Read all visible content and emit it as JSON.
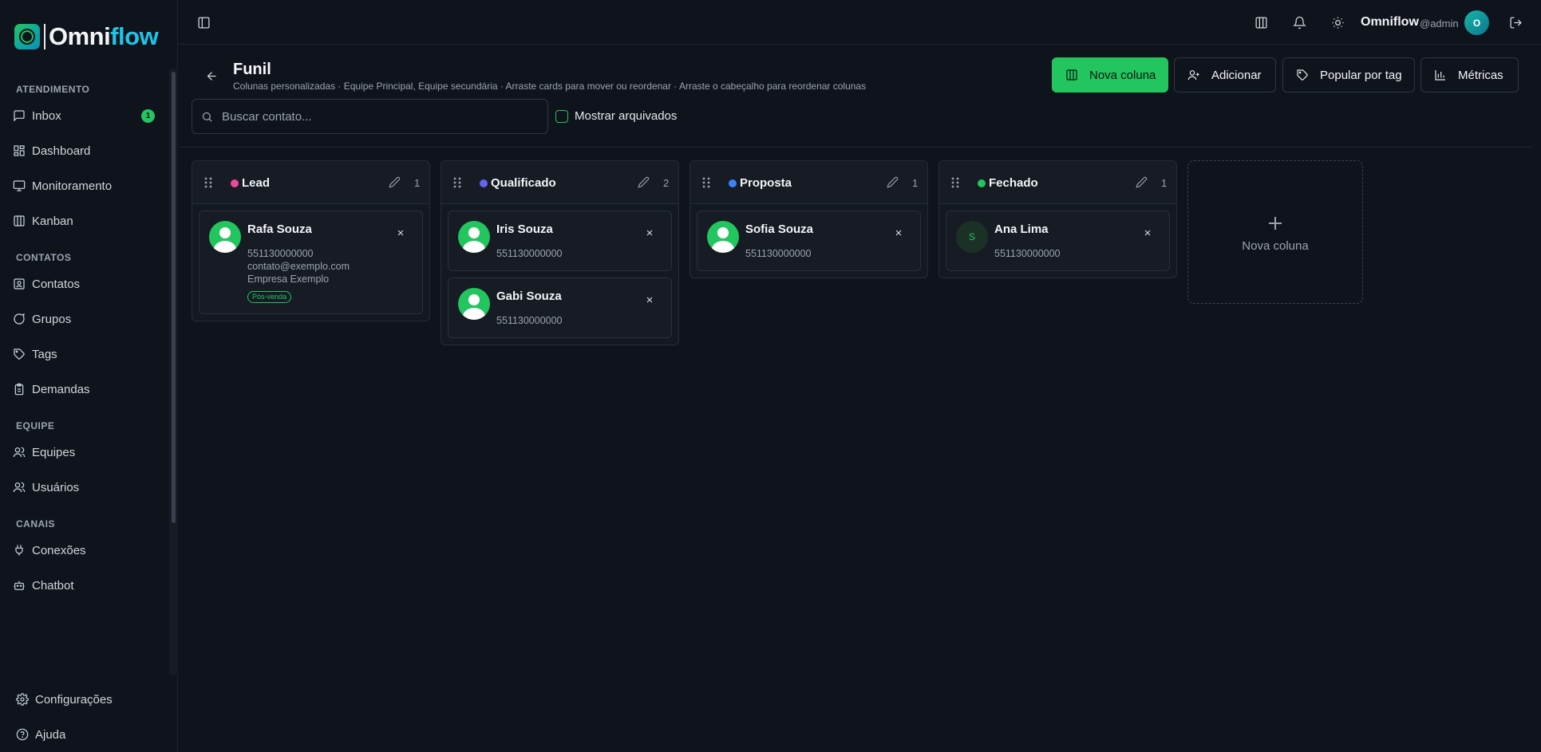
{
  "brand": {
    "part1": "Omni",
    "part2": "flow"
  },
  "sidebar": {
    "sections": [
      {
        "title": "ATENDIMENTO",
        "items": [
          {
            "label": "Inbox",
            "icon": "message-square-icon",
            "badge": "1"
          },
          {
            "label": "Dashboard",
            "icon": "dashboard-icon"
          },
          {
            "label": "Monitoramento",
            "icon": "monitor-icon"
          },
          {
            "label": "Kanban",
            "icon": "kanban-icon"
          }
        ]
      },
      {
        "title": "CONTATOS",
        "items": [
          {
            "label": "Contatos",
            "icon": "contact-icon"
          },
          {
            "label": "Grupos",
            "icon": "chat-bubble-icon"
          },
          {
            "label": "Tags",
            "icon": "tag-icon"
          },
          {
            "label": "Demandas",
            "icon": "clipboard-icon"
          }
        ]
      },
      {
        "title": "EQUIPE",
        "items": [
          {
            "label": "Equipes",
            "icon": "users-icon"
          },
          {
            "label": "Usuários",
            "icon": "users-icon"
          }
        ]
      },
      {
        "title": "CANAIS",
        "items": [
          {
            "label": "Conexões",
            "icon": "plug-icon"
          },
          {
            "label": "Chatbot",
            "icon": "bot-icon"
          }
        ]
      }
    ],
    "bottom": [
      {
        "label": "Configurações",
        "icon": "gear-icon"
      },
      {
        "label": "Ajuda",
        "icon": "help-circle-icon"
      }
    ]
  },
  "topbar": {
    "user_name": "Omniflow",
    "user_handle": "@admin",
    "avatar_initial": "O"
  },
  "page": {
    "title": "Funil",
    "subtitle": "Colunas personalizadas · Equipe Principal, Equipe secundária · Arraste cards para mover ou reordenar · Arraste o cabeçalho para reordenar colunas",
    "buttons": {
      "new_column": "Nova coluna",
      "add": "Adicionar",
      "populate": "Popular por tag",
      "metrics": "Métricas"
    },
    "search_placeholder": "Buscar contato...",
    "show_archived": "Mostrar arquivados"
  },
  "columns": [
    {
      "title": "Lead",
      "color": "#ec4899",
      "count": "1",
      "cards": [
        {
          "name": "Rafa Souza",
          "phone": "551130000000",
          "email": "contato@exemplo.com",
          "company": "Empresa Exemplo",
          "tag": "Pós-venda",
          "avatar": "photo"
        }
      ]
    },
    {
      "title": "Qualificado",
      "color": "#6366f1",
      "count": "2",
      "cards": [
        {
          "name": "Iris Souza",
          "phone": "551130000000",
          "avatar": "photo"
        },
        {
          "name": "Gabi Souza",
          "phone": "551130000000",
          "avatar": "photo"
        }
      ]
    },
    {
      "title": "Proposta",
      "color": "#3b82f6",
      "count": "1",
      "cards": [
        {
          "name": "Sofia Souza",
          "phone": "551130000000",
          "avatar": "photo"
        }
      ]
    },
    {
      "title": "Fechado",
      "color": "#22c55e",
      "count": "1",
      "cards": [
        {
          "name": "Ana Lima",
          "phone": "551130000000",
          "avatar": "letter",
          "initial": "S"
        }
      ]
    }
  ],
  "new_column_placeholder": "Nova coluna",
  "colors": {
    "accent": "#22c55e",
    "background": "#0f141c"
  }
}
